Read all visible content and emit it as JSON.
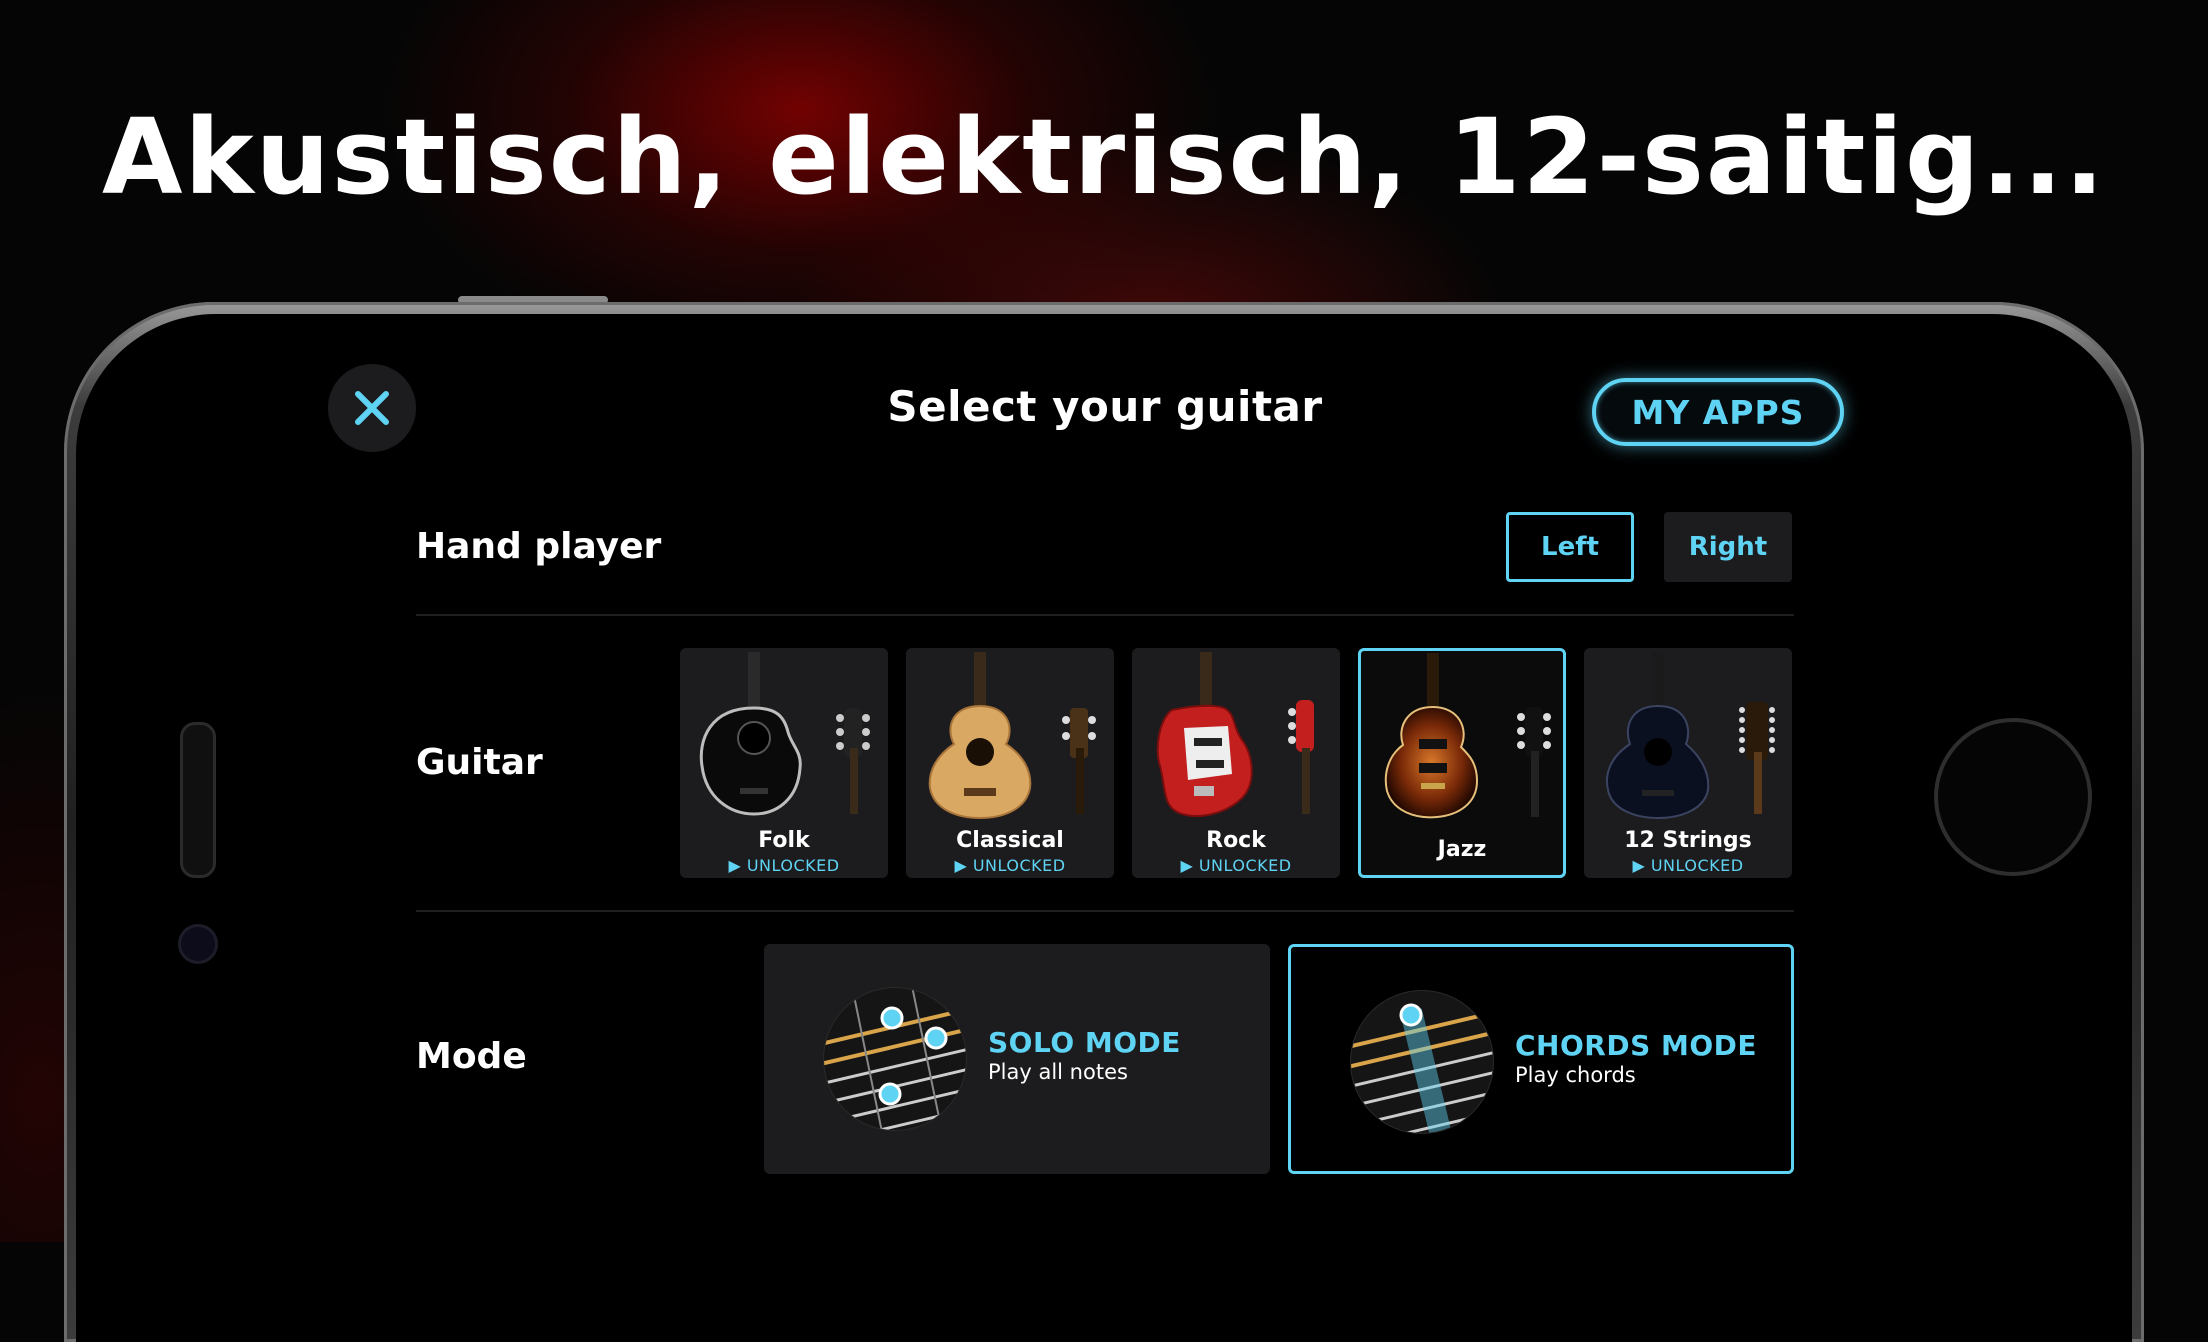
{
  "headline": "Akustisch, elektrisch, 12-saitig...",
  "screen": {
    "title": "Select your guitar",
    "my_apps_label": "MY APPS",
    "close_icon": "close-icon"
  },
  "hand": {
    "label": "Hand player",
    "options": [
      "Left",
      "Right"
    ],
    "selected": "Left"
  },
  "guitar": {
    "label": "Guitar",
    "items": [
      {
        "name": "Folk",
        "status": "UNLOCKED",
        "selected": false
      },
      {
        "name": "Classical",
        "status": "UNLOCKED",
        "selected": false
      },
      {
        "name": "Rock",
        "status": "UNLOCKED",
        "selected": false
      },
      {
        "name": "Jazz",
        "status": "",
        "selected": true
      },
      {
        "name": "12 Strings",
        "status": "UNLOCKED",
        "selected": false
      }
    ]
  },
  "mode": {
    "label": "Mode",
    "items": [
      {
        "title": "SOLO MODE",
        "subtitle": "Play all notes",
        "selected": false
      },
      {
        "title": "CHORDS MODE",
        "subtitle": "Play chords",
        "selected": true
      }
    ]
  },
  "colors": {
    "accent": "#5fd3f3",
    "card": "#1c1c1e",
    "background": "#000000"
  }
}
